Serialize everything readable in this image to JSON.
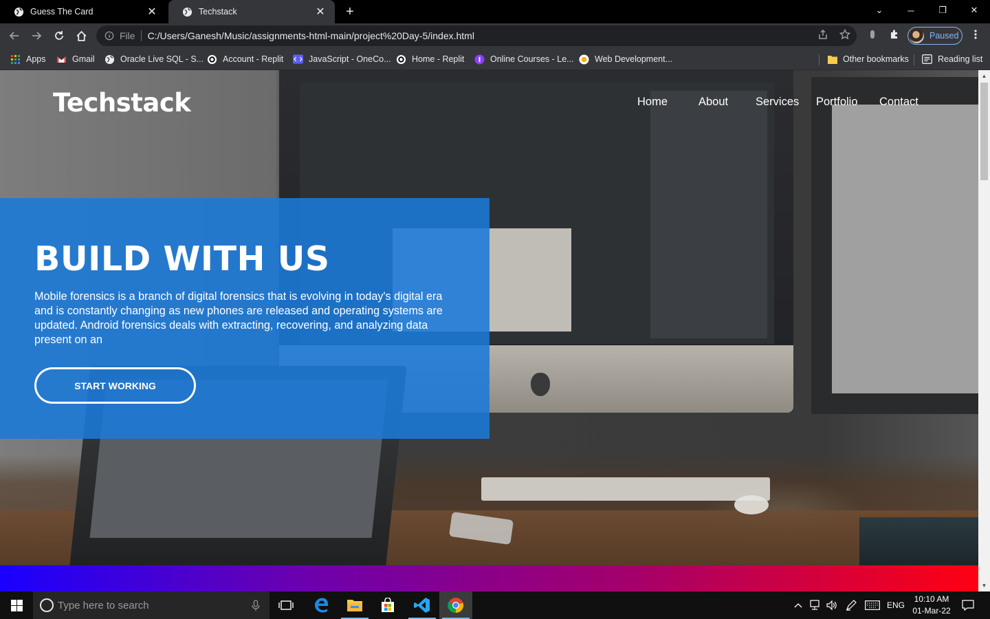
{
  "browser": {
    "tabs": [
      {
        "title": "Guess The Card",
        "close": "✕"
      },
      {
        "title": "Techstack",
        "close": "✕"
      }
    ],
    "new_tab": "+",
    "window_controls": {
      "minimize": "─",
      "restore": "❐",
      "close": "✕",
      "tab_search": "⌄"
    },
    "address": {
      "file_label": "File",
      "url": "C:/Users/Ganesh/Music/assignments-html-main/project%20Day-5/index.html"
    },
    "profile_label": "Paused",
    "bookmarks": [
      {
        "label": "Apps",
        "icon": "apps-grid-icon"
      },
      {
        "label": "Gmail",
        "icon": "gmail-icon"
      },
      {
        "label": "Oracle Live SQL - S...",
        "icon": "globe-icon"
      },
      {
        "label": "Account - Replit",
        "icon": "replit-icon"
      },
      {
        "label": "JavaScript - OneCo...",
        "icon": "onecompiler-icon"
      },
      {
        "label": "Home - Replit",
        "icon": "replit-icon"
      },
      {
        "label": "Online Courses - Le...",
        "icon": "courses-icon"
      },
      {
        "label": "Web Development...",
        "icon": "webdev-icon"
      }
    ],
    "other_bookmarks": "Other bookmarks",
    "reading_list": "Reading list"
  },
  "page": {
    "logo": "Techstack",
    "nav": [
      "Home",
      "About",
      "Services",
      "Portfolio",
      "Contact"
    ],
    "hero": {
      "title": "BUILD WITH US",
      "text": "Mobile forensics is a branch of digital forensics that is evolving in today's digital era and is constantly changing as new phones are released and operating systems are updated. Android forensics deals with extracting, recovering, and analyzing data present on an",
      "cta": "START WORKING"
    },
    "colors": {
      "hero_box": "#1a7ada",
      "gradient_start": "#1a00ff",
      "gradient_end": "#ff0012"
    }
  },
  "taskbar": {
    "search_placeholder": "Type here to search",
    "language": "ENG",
    "time": "10:10 AM",
    "date": "01-Mar-22"
  }
}
